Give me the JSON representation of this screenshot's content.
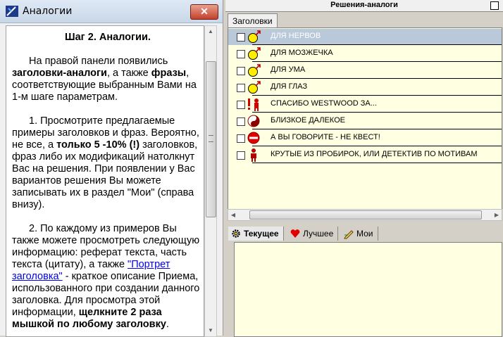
{
  "left": {
    "title": "Аналогии",
    "close_glyph": "✕",
    "heading": "Шаг 2. Аналогии.",
    "p1": [
      {
        "t": "На правой панели появились "
      },
      {
        "t": "заголовки-аналоги",
        "b": true
      },
      {
        "t": ", а также "
      },
      {
        "t": "фразы",
        "b": true
      },
      {
        "t": ", соответствующие выбранным Вами на 1-м шаге параметрам."
      }
    ],
    "p2": [
      {
        "t": "1. Просмотрите предлагаемые примеры заголовков и фраз.  Вероятно, не все, а "
      },
      {
        "t": "только 5 -10% (!)",
        "b": true
      },
      {
        "t": " заголовков, фраз либо их модификаций натолкнут Вас на решения. При появлении у Вас вариантов решения Вы можете записывать их в раздел \"Мои\" (справа внизу)."
      }
    ],
    "p3": [
      {
        "t": "2. По каждому из примеров Вы также можете просмотреть следующую информацию: реферат текста, часть текста (цитату), а также "
      },
      {
        "t": "\"Портрет заголовка\"",
        "a": true
      },
      {
        "t": " - краткое описание Приема, использованного при создании данного заголовка. Для просмотра этой информации, "
      },
      {
        "t": "щелкните 2 раза мышкой по любому заголовку",
        "b": true
      },
      {
        "t": "."
      }
    ]
  },
  "right": {
    "title": "Решения-аналоги",
    "tab_headlines": "Заголовки",
    "rows": [
      {
        "label": "ДЛЯ НЕРВОВ",
        "icon": "gender-male-icon",
        "selected": true
      },
      {
        "label": "ДЛЯ МОЗЖЕЧКА",
        "icon": "gender-male-icon",
        "selected": false
      },
      {
        "label": "ДЛЯ УМА",
        "icon": "gender-male-icon",
        "selected": false
      },
      {
        "label": "ДЛЯ ГЛАЗ",
        "icon": "gender-male-icon",
        "selected": false
      },
      {
        "label": "СПАСИБО WESTWOOD ЗА...",
        "icon": "exclamation-person-icon",
        "selected": false
      },
      {
        "label": "БЛИЗКОЕ ДАЛЕКОЕ",
        "icon": "yin-yang-icon",
        "selected": false
      },
      {
        "label": "А ВЫ ГОВОРИТЕ - НЕ КВЕСТ!",
        "icon": "no-entry-icon",
        "selected": false
      },
      {
        "label": "КРУТЫЕ ИЗ ПРОБИРОК, ИЛИ ДЕТЕКТИВ ПО МОТИВАМ",
        "icon": "person-icon",
        "selected": false
      }
    ],
    "bottom_tabs": [
      {
        "label": "Текущее",
        "icon": "gear-icon",
        "active": true
      },
      {
        "label": "Лучшее",
        "icon": "heart-icon",
        "active": false
      },
      {
        "label": "Мои",
        "icon": "pencil-icon",
        "active": false
      }
    ]
  }
}
